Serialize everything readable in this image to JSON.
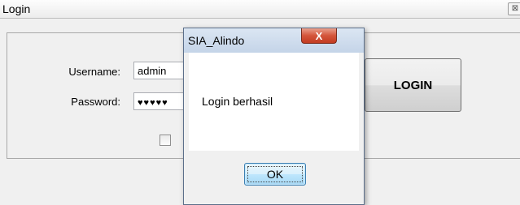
{
  "login_window": {
    "title": "Login",
    "close_glyph": "⊠",
    "username_label": "Username:",
    "username_value": "admin",
    "password_label": "Password:",
    "password_value": "♥♥♥♥♥",
    "login_button": "LOGIN"
  },
  "message_box": {
    "title": "SIA_Alindo",
    "close_glyph": "X",
    "message": "Login berhasil",
    "ok_button": "OK"
  },
  "colors": {
    "close_button_red": "#c23b20",
    "ok_button_blue": "#bee6fd",
    "dialog_titlebar": "#c4d4e8"
  }
}
